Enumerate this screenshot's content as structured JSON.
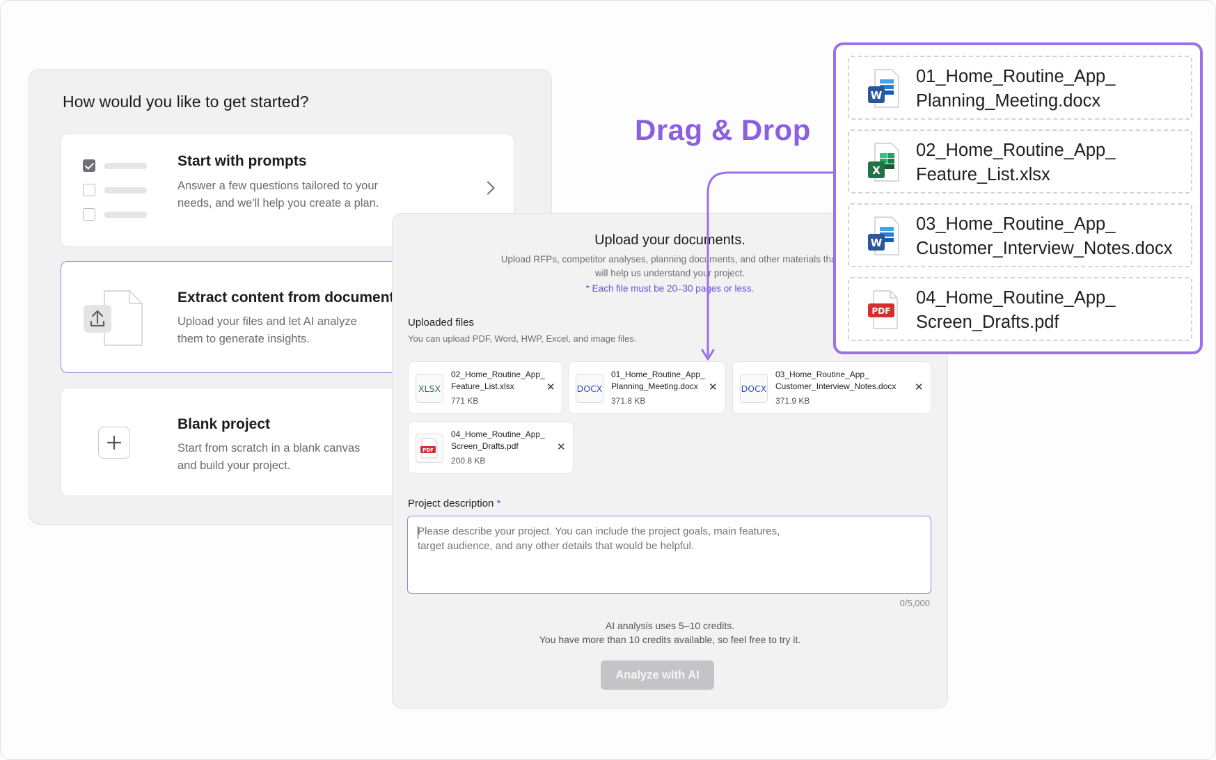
{
  "left_panel": {
    "title": "How would you like to get started?",
    "options": [
      {
        "title": "Start with prompts",
        "description": "Answer a few questions tailored to your needs, and we'll help you create a plan."
      },
      {
        "title": "Extract content from documents",
        "description": "Upload your files and let AI analyze them to generate insights."
      },
      {
        "title": "Blank project",
        "description": "Start from scratch in a blank canvas and build your project."
      }
    ]
  },
  "upload_panel": {
    "title": "Upload your documents.",
    "subtitle": "Upload RFPs, competitor analyses, planning documents, and other materials that will help us understand your project.",
    "note": "* Each file must be 20–30 pages or less.",
    "uploaded_label": "Uploaded files",
    "uploaded_hint": "You can upload PDF, Word, HWP, Excel, and image files.",
    "files": [
      {
        "type": "XLSX",
        "name": "02_Home_Routine_App_ Feature_List.xlsx",
        "size": "771 KB"
      },
      {
        "type": "DOCX",
        "name": "01_Home_Routine_App_ Planning_Meeting.docx",
        "size": "371.8 KB"
      },
      {
        "type": "DOCX",
        "name": "03_Home_Routine_App_ Customer_Interview_Notes.docx",
        "size": "371.9 KB"
      },
      {
        "type": "PDF",
        "name": "04_Home_Routine_App_ Screen_Drafts.pdf",
        "size": "200.8 KB"
      }
    ],
    "description_label": "Project description",
    "required_mark": "*",
    "description_placeholder": "Please describe your project. You can include the project goals, main features, target audience, and any other details that would be helpful.",
    "char_counter": "0/5,000",
    "credits_line1": "AI analysis uses 5–10 credits.",
    "credits_line2": "You have more than 10 credits available, so feel free to try it.",
    "analyze_button": "Analyze with AI"
  },
  "drag_drop": {
    "label": "Drag & Drop",
    "files": [
      {
        "icon": "word-icon",
        "name": "01_Home_Routine_App_ Planning_Meeting.docx"
      },
      {
        "icon": "excel-icon",
        "name": "02_Home_Routine_App_ Feature_List.xlsx"
      },
      {
        "icon": "word-icon",
        "name": "03_Home_Routine_App_ Customer_Interview_Notes.docx"
      },
      {
        "icon": "pdf-icon",
        "name": "04_Home_Routine_App_ Screen_Drafts.pdf"
      }
    ]
  },
  "colors": {
    "accent_purple": "#8a5fe0",
    "selected_border": "#8a86dc",
    "word_blue": "#2b579a",
    "excel_green": "#217346",
    "pdf_red": "#d32f2f"
  }
}
